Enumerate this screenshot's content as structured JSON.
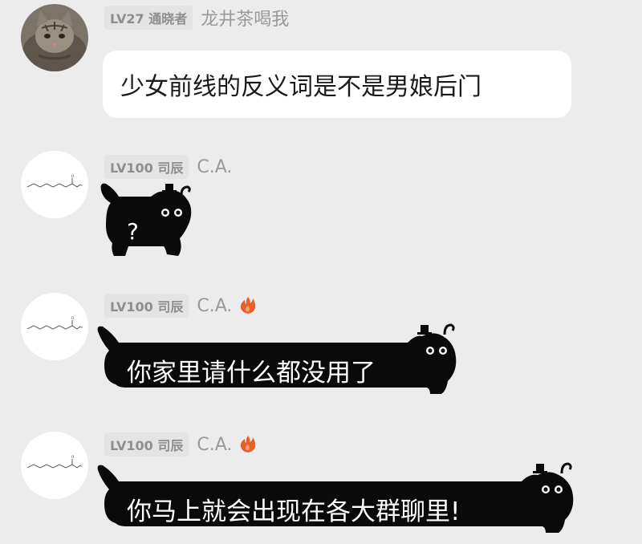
{
  "messages": [
    {
      "level": "LV27",
      "title": "通晓者",
      "username": "龙井茶喝我",
      "text": "少女前线的反义词是不是男娘后门",
      "avatar_icon": "tabby-cat-photo",
      "has_fire_icon": false
    },
    {
      "level": "LV100",
      "title": "司辰",
      "username": "C.A.",
      "text": "?",
      "avatar_icon": "chemical-structure",
      "has_fire_icon": false
    },
    {
      "level": "LV100",
      "title": "司辰",
      "username": "C.A.",
      "text": "你家里请什么都没用了",
      "avatar_icon": "chemical-structure",
      "has_fire_icon": true
    },
    {
      "level": "LV100",
      "title": "司辰",
      "username": "C.A.",
      "text": "你马上就会出现在各大群聊里!",
      "avatar_icon": "chemical-structure",
      "has_fire_icon": true
    }
  ],
  "colors": {
    "background": "#ececec",
    "bubble": "#ffffff",
    "sticker": "#0a0a0a",
    "badge_bg": "#e4e4e4",
    "badge_text": "#8e8e8e",
    "fire": "#e8602c"
  }
}
